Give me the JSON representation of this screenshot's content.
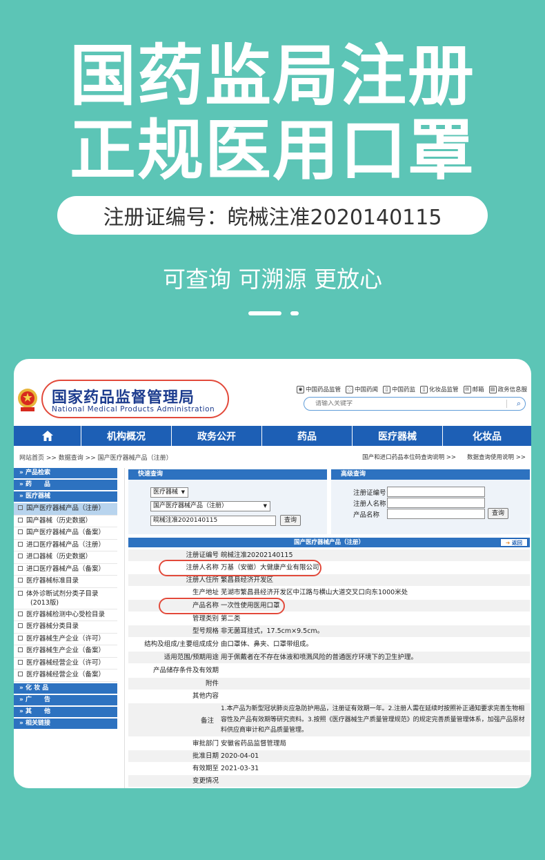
{
  "headline": {
    "line1": "国药监局注册",
    "line2": "正规医用口罩"
  },
  "reg_pill": "注册证编号：皖械注准2020140115",
  "tagline": "可查询 可溯源 更放心",
  "site": {
    "name_cn": "国家药品监督管理局",
    "name_en": "National Medical Products Administration",
    "top_links": [
      "中国药品监管",
      "中国药闻",
      "中国药监",
      "化妆品监管",
      "邮箱",
      "政务信息服"
    ],
    "search_placeholder": "请输入关键字",
    "nav": [
      "机构概况",
      "政务公开",
      "药品",
      "医疗器械",
      "化妆品"
    ],
    "breadcrumb": "网站首页 >> 数据查询 >> 国产医疗器械产品（注册）",
    "breadcrumb_links": [
      "国产和进口药品本位码查询说明 >>",
      "数据查询使用说明 >>"
    ]
  },
  "sidebar": {
    "head_products": "» 产品检索",
    "head_drugs": "» 药　　品",
    "head_devices": "» 医疗器械",
    "items": [
      "国产医疗器械产品（注册）",
      "国产器械（历史数据）",
      "国产医疗器械产品（备案）",
      "进口医疗器械产品（注册）",
      "进口器械（历史数据）",
      "进口医疗器械产品（备案）",
      "医疗器械标准目录",
      "体外诊断试剂分类子目录",
      "(2013版)",
      "医疗器械检测中心受检目录",
      "医疗器械分类目录",
      "医疗器械生产企业（许可）",
      "医疗器械生产企业（备案）",
      "医疗器械经营企业（许可）",
      "医疗器械经营企业（备案）"
    ],
    "head_cosmetics": "» 化 妆 品",
    "head_ads": "» 广　　告",
    "head_other": "» 其　　他",
    "head_links": "» 相关链接"
  },
  "quick": {
    "title": "快速查询",
    "category": "医疗器械",
    "database": "国产医疗器械产品（注册）",
    "query": "皖械注准2020140115",
    "button": "查询"
  },
  "advanced": {
    "title": "高级查询",
    "label_reg_no": "注册证编号",
    "label_registrant": "注册人名称",
    "label_product": "产品名称",
    "button": "查询"
  },
  "result": {
    "title": "国产医疗器械产品（注册）",
    "back": "返回",
    "fields": [
      {
        "k": "注册证编号",
        "v": "皖械注准20202140115"
      },
      {
        "k": "注册人名称",
        "v": "万基（安徽）大健康产业有限公司"
      },
      {
        "k": "注册人住所",
        "v": "繁昌县经济开发区"
      },
      {
        "k": "生产地址",
        "v": "芜湖市繁昌县经济开发区中江路与横山大道交叉口向东1000米处"
      },
      {
        "k": "产品名称",
        "v": "一次性使用医用口罩"
      },
      {
        "k": "管理类别",
        "v": "第二类"
      },
      {
        "k": "型号规格",
        "v": "非无菌耳挂式，17.5cm×9.5cm。"
      },
      {
        "k": "结构及组成/主要组成成分",
        "v": "由口罩体、鼻夹、口罩带组成。"
      },
      {
        "k": "适用范围/预期用途",
        "v": "用于佩戴者在不存在体液和喷溅风险的普通医疗环境下的卫生护理。"
      },
      {
        "k": "产品储存条件及有效期",
        "v": ""
      },
      {
        "k": "附件",
        "v": ""
      },
      {
        "k": "其他内容",
        "v": ""
      }
    ],
    "note_key": "备注",
    "note_text": "1.本产品为新型冠状肺炎应急防护用品，注册证有效期一年。2.注册人需在延续时按照补正通知要求完善生物相容性及产品有效期等研究资料。3.按照《医疗器械生产质量管理规范》的规定完善质量管理体系，加强产品原材料供应商审计和产品质量管理。",
    "fields2": [
      {
        "k": "审批部门",
        "v": "安徽省药品监督管理局"
      },
      {
        "k": "批准日期",
        "v": "2020-04-01"
      },
      {
        "k": "有效期至",
        "v": "2021-03-31"
      },
      {
        "k": "变更情况",
        "v": ""
      }
    ]
  },
  "colors": {
    "background": "#5cc5b6",
    "nav_blue": "#1d5fb5",
    "highlight_ring": "#e2493a"
  }
}
